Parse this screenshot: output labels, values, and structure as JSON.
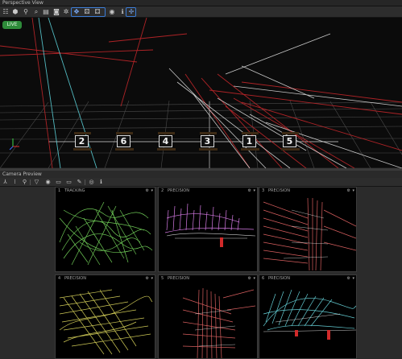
{
  "app": {
    "window_title": "Perspective View"
  },
  "toolbar": {
    "icons": [
      "menu-icon",
      "camera-3d-icon",
      "zoom-icon",
      "zoom-fit-icon",
      "layers-icon",
      "snapshot-icon",
      "settings-icon",
      "view-mode-icon",
      "view-mode-2-icon",
      "view-mode-3-icon",
      "visibility-icon",
      "info-icon",
      "pin-icon"
    ]
  },
  "viewport": {
    "live_label": "LIVE",
    "markers": [
      "2",
      "6",
      "4",
      "3",
      "1",
      "5"
    ],
    "marker_line_color": "#9b1f1f"
  },
  "camera_panel": {
    "title": "Camera Preview",
    "toolbar_icons": [
      "layout-icon",
      "grid-icon",
      "zoom-icon",
      "filter-icon",
      "record-icon",
      "film-icon",
      "pen-icon",
      "eye-icon",
      "info-icon"
    ]
  },
  "cameras": [
    {
      "number": "1",
      "mode": "TRACKING",
      "color": "#7be060"
    },
    {
      "number": "2",
      "mode": "PRECISION",
      "color": "#d77be6"
    },
    {
      "number": "3",
      "mode": "PRECISION",
      "color": "#f06a6a"
    },
    {
      "number": "4",
      "mode": "PRECISION",
      "color": "#e6e060"
    },
    {
      "number": "5",
      "mode": "PRECISION",
      "color": "#f06a6a"
    },
    {
      "number": "6",
      "mode": "PRECISION",
      "color": "#6fe3ea"
    }
  ],
  "colors": {
    "live_green": "#2e8b3a",
    "accent_blue": "#3a7bd5"
  }
}
